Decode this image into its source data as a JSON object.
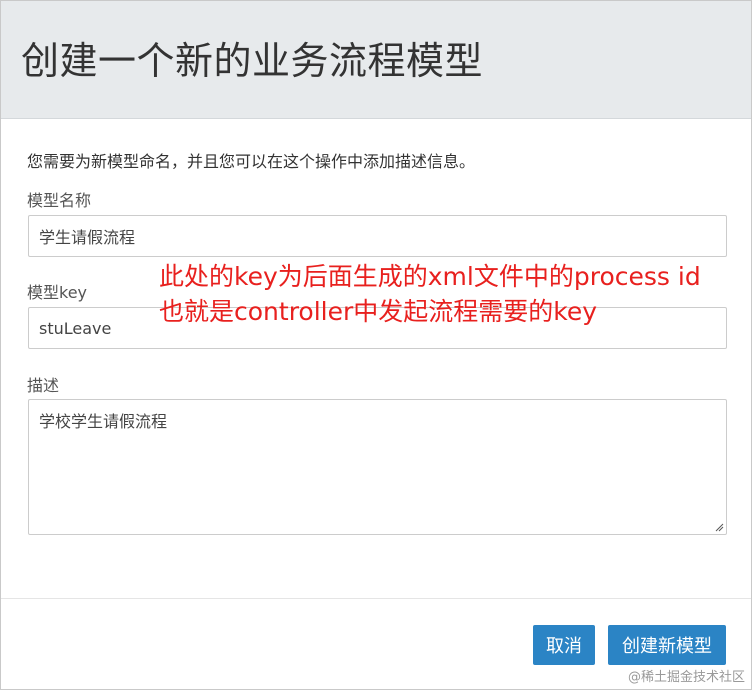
{
  "dialog": {
    "title": "创建一个新的业务流程模型",
    "intro": "您需要为新模型命名，并且您可以在这个操作中添加描述信息。"
  },
  "form": {
    "name_label": "模型名称",
    "name_value": "学生请假流程",
    "key_label": "模型key",
    "key_value": "stuLeave",
    "description_label": "描述",
    "description_value": "学校学生请假流程"
  },
  "annotation": {
    "line1": "此处的key为后面生成的xml文件中的process id",
    "line2": "也就是controller中发起流程需要的key",
    "color": "#e8201e"
  },
  "footer": {
    "cancel_label": "取消",
    "create_label": "创建新模型",
    "button_color": "#2b84c5"
  },
  "watermark": "@稀土掘金技术社区"
}
